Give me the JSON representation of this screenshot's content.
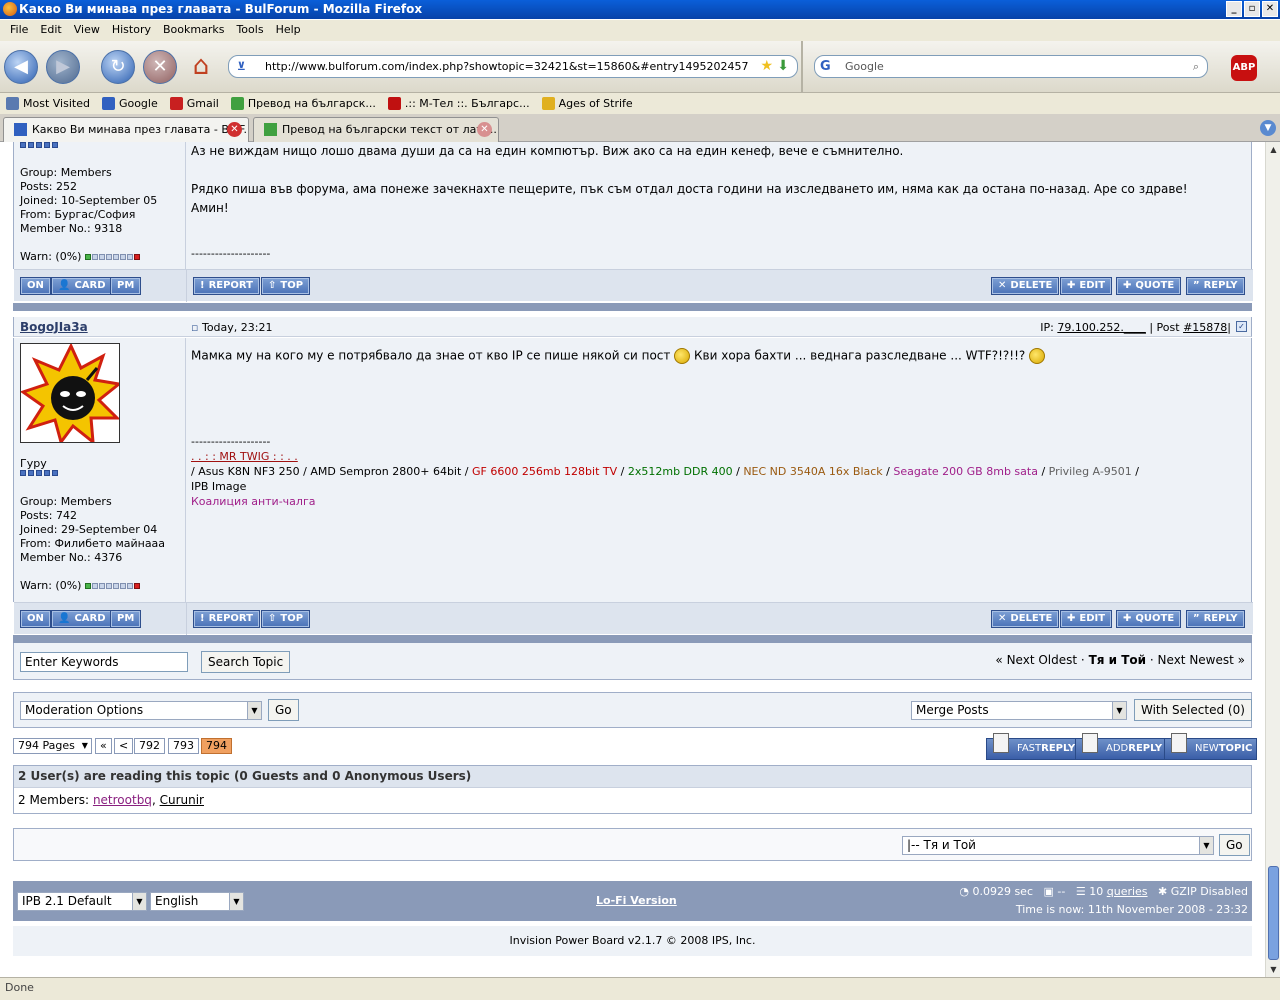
{
  "window": {
    "title": "Какво Ви минава през главата - BulForum - Mozilla Firefox",
    "controls": [
      "_",
      "▫",
      "✕"
    ]
  },
  "menu": [
    "File",
    "Edit",
    "View",
    "History",
    "Bookmarks",
    "Tools",
    "Help"
  ],
  "navbar": {
    "url": "http://www.bulforum.com/index.php?showtopic=32421&st=15860&#entry1495202457",
    "search_placeholder": "Google",
    "adblock": "ABP"
  },
  "bookmarks": [
    {
      "label": "Most Visited",
      "color": "#5a7ab0"
    },
    {
      "label": "Google",
      "color": "#3060c0"
    },
    {
      "label": "Gmail",
      "color": "#c82020"
    },
    {
      "label": "Превод на българск...",
      "color": "#40a040"
    },
    {
      "label": ".:: М-Тел ::. Българс...",
      "color": "#c01010"
    },
    {
      "label": "Ages of Strife",
      "color": "#e0b020"
    }
  ],
  "tabs": [
    {
      "label": "Какво Ви минава през главата - BulF...",
      "active": true
    },
    {
      "label": "Превод на български текст от лати...",
      "active": false
    }
  ],
  "post1": {
    "group": "Group: Members",
    "posts": "Posts: 252",
    "joined": "Joined: 10-September 05",
    "from": "From: Бургас/София",
    "member_no": "Member No.: 9318",
    "warn": "Warn: (0%)",
    "text_line1": "Аз не виждам нищо лошо двама души да са на един компютър. Виж ако са на един кенеф, вече е съмнително.",
    "text_line2": "Рядко пиша във форума, ама понеже зачекнахте пещерите, пък съм отдал доста години на изследването им, няма как да остана по-назад. Аре со здраве!",
    "text_line3": "Амин!",
    "sig_sep": "--------------------"
  },
  "buttons": {
    "on": "ON",
    "card": "CARD",
    "pm": "PM",
    "report": "REPORT",
    "top": "TOP",
    "delete": "DELETE",
    "edit": "EDIT",
    "quote": "QUOTE",
    "reply": "REPLY"
  },
  "post2": {
    "author": "BogoJIa3a",
    "date": "Today, 23:21",
    "ip_label": "IP:",
    "ip": "79.100.252.____",
    "post_label": "| Post",
    "post_no": "#15878",
    "rank": "Гуру",
    "group": "Group: Members",
    "posts": "Posts: 742",
    "joined": "Joined: 29-September 04",
    "from": "From: Филибето майнааа",
    "member_no": "Member No.: 4376",
    "warn": "Warn: (0%)",
    "text_a": "Мамка му на кого му е потрябвало да знае от кво IP се пише някой си пост",
    "text_b": "Кви хора бахти ... веднага разследване ... WTF?!?!!?",
    "sig_sep": "--------------------",
    "sig_name": ". . : : MR TWIG : : . .",
    "sig_specs": [
      {
        "text": "/ Asus K8N NF3 250 / AMD Sempron 2800+ 64bit / ",
        "cls": ""
      },
      {
        "text": "GF 6600 256mb 128bit TV",
        "cls": "sig-red"
      },
      {
        "text": " / ",
        "cls": ""
      },
      {
        "text": "2x512mb DDR 400",
        "cls": "sig-green"
      },
      {
        "text": " / ",
        "cls": ""
      },
      {
        "text": "NEC ND 3540A 16x Black",
        "cls": "sig-brown"
      },
      {
        "text": " / ",
        "cls": ""
      },
      {
        "text": "Seagate 200 GB 8mb sata",
        "cls": "sig-mag"
      },
      {
        "text": " / ",
        "cls": ""
      },
      {
        "text": "Privileg A-9501",
        "cls": "sig-gray"
      },
      {
        "text": " /",
        "cls": ""
      }
    ],
    "sig_image": "IPB Image",
    "sig_coalition": "Коалиция анти-чалга"
  },
  "search": {
    "placeholder": "Enter Keywords",
    "button": "Search Topic",
    "next_oldest": "« Next Oldest",
    "sep": "·",
    "topic": "Тя и Той",
    "next_newest": "Next Newest »"
  },
  "moderation": {
    "select": "Moderation Options",
    "go": "Go",
    "merge": "Merge Posts",
    "with_selected": "With Selected (0)"
  },
  "pagination": {
    "pages": "794 Pages",
    "first": "«",
    "prev": "<",
    "p1": "792",
    "p2": "793",
    "current": "794"
  },
  "topic_buttons": {
    "fast_reply_a": "FAST",
    "fast_reply_b": "REPLY",
    "add_reply_a": "ADD",
    "add_reply_b": "REPLY",
    "new_topic_a": "NEW",
    "new_topic_b": "TOPIC"
  },
  "readers": {
    "header": "2 User(s) are reading this topic (0 Guests and 0 Anonymous Users)",
    "members_label": "2 Members:",
    "member1": "netrootbq",
    "member2": "Curunir"
  },
  "jump": {
    "select": "|-- Тя и Той",
    "go": "Go"
  },
  "footer": {
    "skin": "IPB 2.1 Default",
    "lang": "English",
    "lofi": "Lo-Fi Version",
    "time_sec": "0.0929 sec",
    "dash": "--",
    "queries_n": "10",
    "queries": "queries",
    "gzip": "GZIP Disabled",
    "time_now": "Time is now: 11th November 2008 - 23:32",
    "copyright": "Invision Power Board v2.1.7 © 2008  IPS, Inc."
  },
  "status": "Done"
}
